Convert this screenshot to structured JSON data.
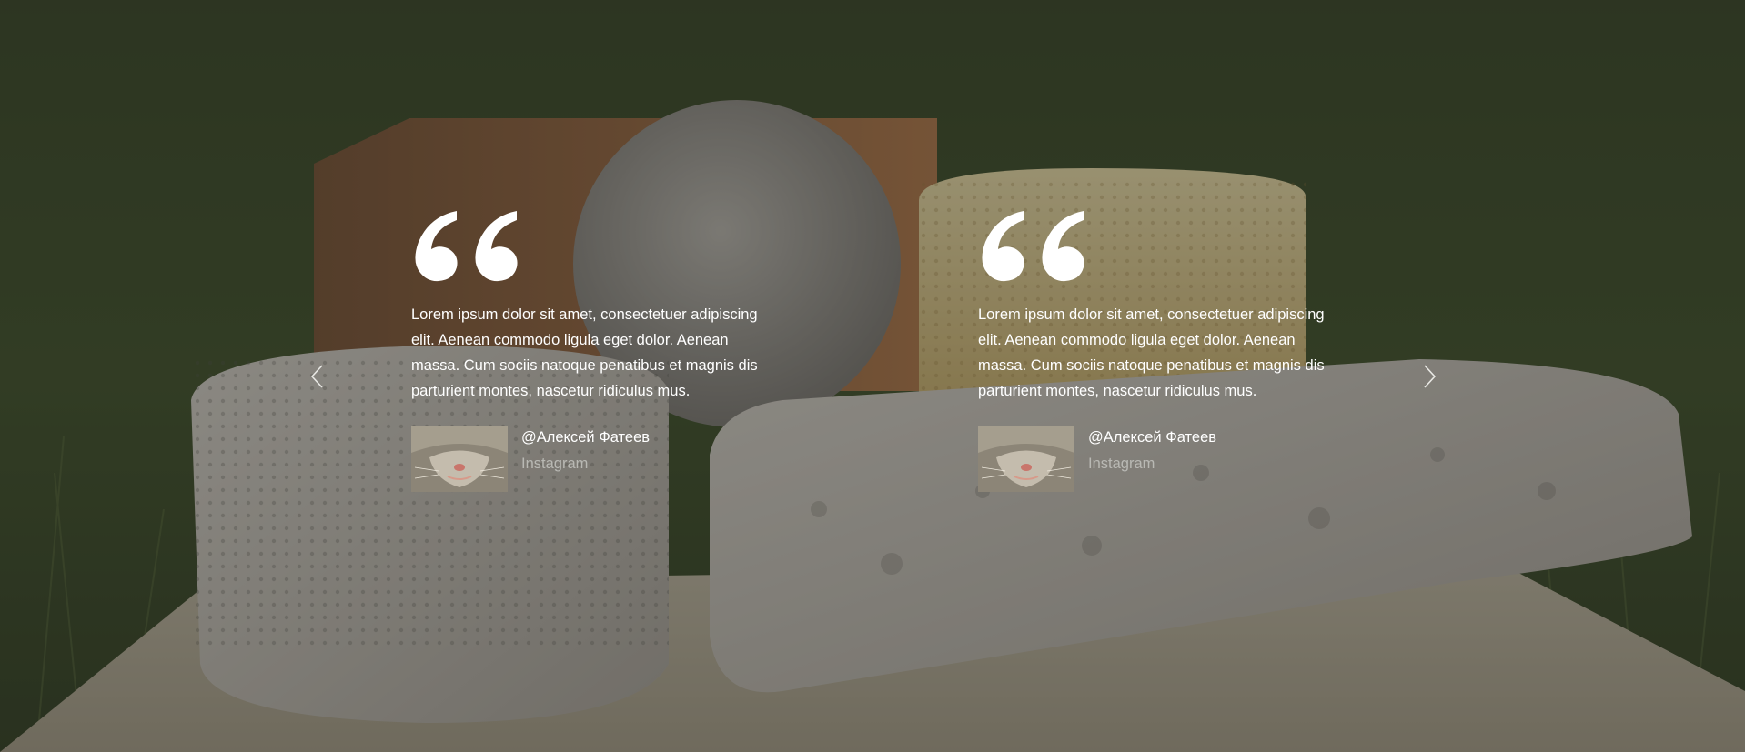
{
  "slider": {
    "prev_icon": "chevron-left-icon",
    "next_icon": "chevron-right-icon"
  },
  "testimonials": [
    {
      "quote_icon": "quote-mark-icon",
      "text": "Lorem ipsum dolor sit amet, consectetuer adipiscing elit. Aenean commodo ligula eget dolor. Aenean massa. Cum sociis natoque penatibus et magnis dis parturient montes, nascetur ridiculus mus.",
      "author": "@Алексей Фатеев",
      "source": "Instagram"
    },
    {
      "quote_icon": "quote-mark-icon",
      "text": "Lorem ipsum dolor sit amet, consectetuer adipiscing elit. Aenean commodo ligula eget dolor. Aenean massa. Cum sociis natoque penatibus et magnis dis parturient montes, nascetur ridiculus mus.",
      "author": "@Алексей Фатеев",
      "source": "Instagram"
    }
  ],
  "colors": {
    "text": "#ffffff",
    "source_text": "#b9b9b4",
    "overlay": "rgba(20,20,20,0.38)"
  }
}
